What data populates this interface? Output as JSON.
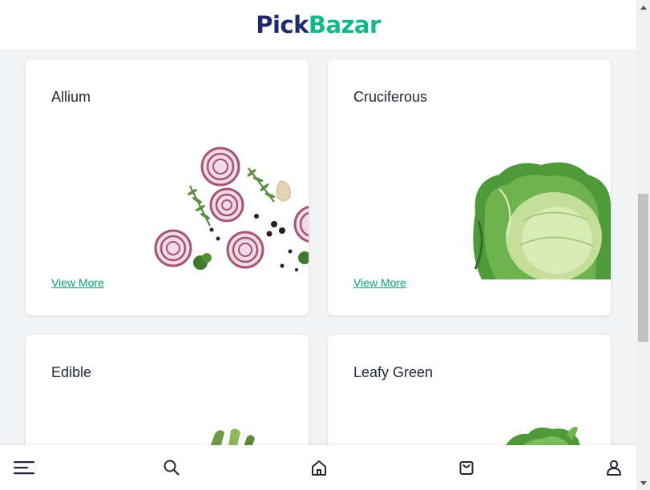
{
  "header": {
    "logo_part1": "Pick",
    "logo_part2": "Bazar",
    "brand_colors": {
      "dark": "#1e2a6b",
      "accent": "#0fb98c"
    }
  },
  "categories": [
    {
      "title": "Allium",
      "link": "View More",
      "image": "onion-rings-image"
    },
    {
      "title": "Cruciferous",
      "link": "View More",
      "image": "cabbage-image"
    },
    {
      "title": "Edible",
      "link": "",
      "image": "asparagus-image"
    },
    {
      "title": "Leafy Green",
      "link": "",
      "image": "lettuce-image"
    }
  ],
  "bottom_nav": {
    "items": [
      {
        "icon": "menu-icon"
      },
      {
        "icon": "search-icon"
      },
      {
        "icon": "home-icon"
      },
      {
        "icon": "shopping-bag-icon"
      },
      {
        "icon": "user-icon"
      }
    ]
  },
  "colors": {
    "link": "#0b9e7a",
    "background": "#f3f4f6"
  }
}
